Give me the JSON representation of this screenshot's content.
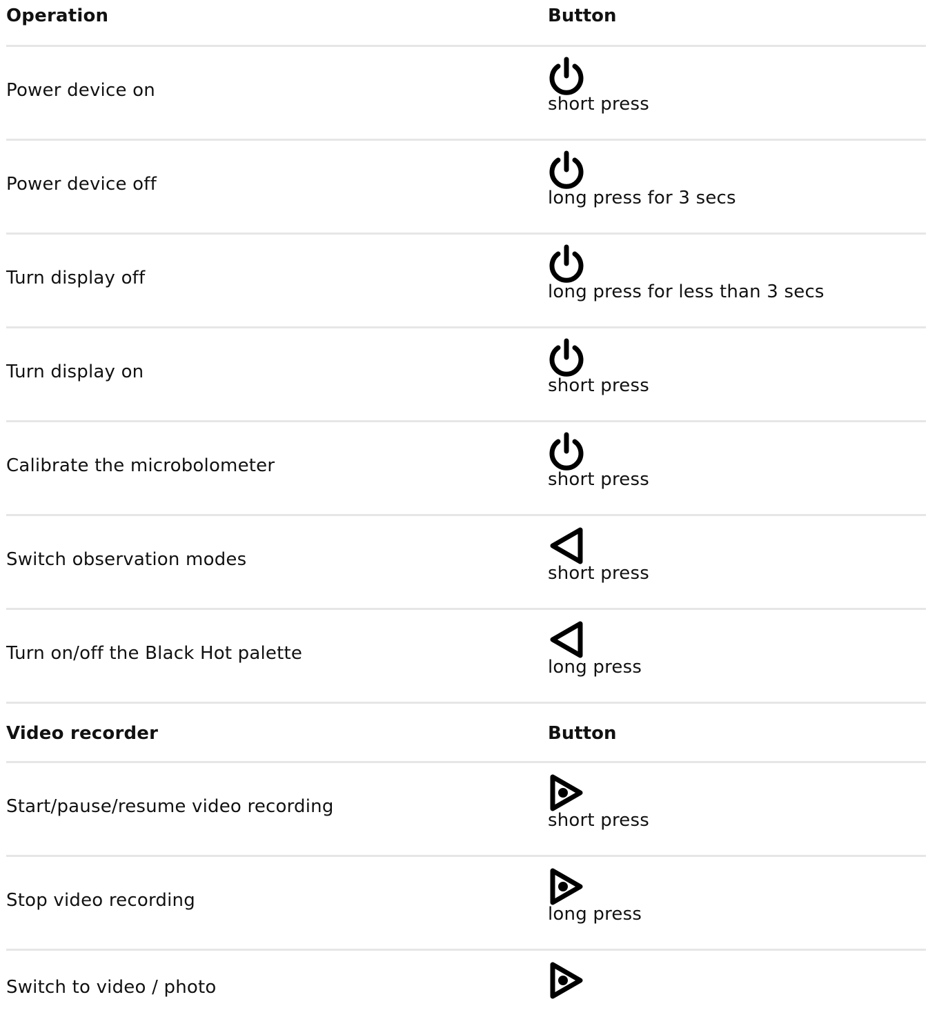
{
  "header": {
    "operation_label": "Operation",
    "button_label": "Button"
  },
  "rows": [
    {
      "operation": "Power device on",
      "icon": "power-icon",
      "press": "short press"
    },
    {
      "operation": "Power device off",
      "icon": "power-icon",
      "press": "long press for 3 secs"
    },
    {
      "operation": "Turn display off",
      "icon": "power-icon",
      "press": "long press for less than 3 secs"
    },
    {
      "operation": "Turn display on",
      "icon": "power-icon",
      "press": "short press"
    },
    {
      "operation": "Calibrate the microbolometer",
      "icon": "power-icon",
      "press": "short press"
    },
    {
      "operation": "Switch observation modes",
      "icon": "triangle-left-icon",
      "press": "short press"
    },
    {
      "operation": "Turn on/off the Black Hot palette",
      "icon": "triangle-left-icon",
      "press": "long press"
    }
  ],
  "video_header": {
    "section_label": "Video recorder",
    "button_label": "Button"
  },
  "video_rows": [
    {
      "operation": "Start/pause/resume video recording",
      "icon": "record-play-icon",
      "press": "short press"
    },
    {
      "operation": "Stop video recording",
      "icon": "record-play-icon",
      "press": "long press"
    },
    {
      "operation": "Switch to video / photo",
      "icon": "record-play-icon",
      "press": ""
    }
  ]
}
